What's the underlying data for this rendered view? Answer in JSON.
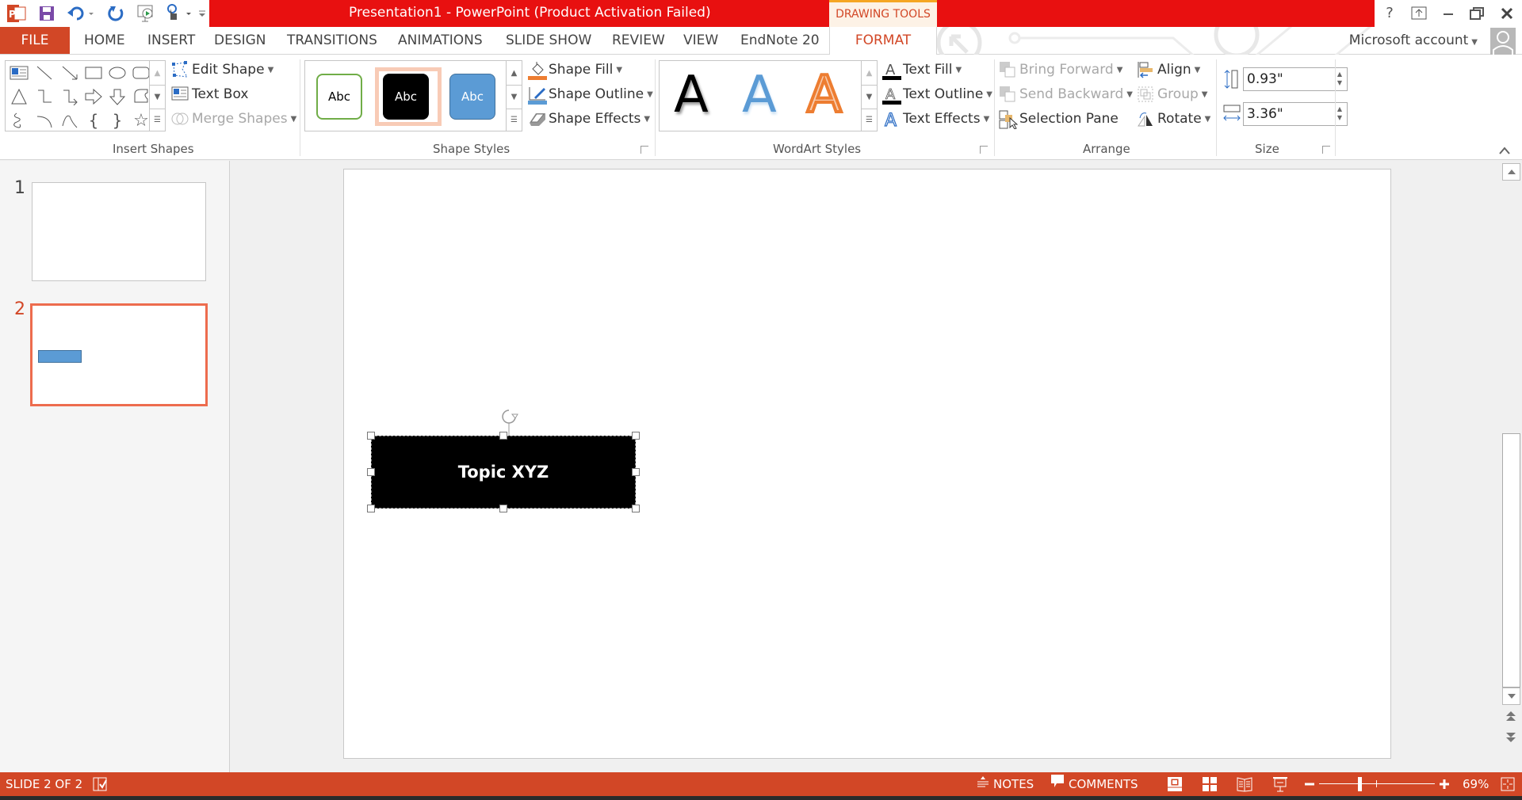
{
  "app": {
    "title": "Presentation1 -  PowerPoint (Product Activation Failed)",
    "contextual_tab_group": "DRAWING TOOLS",
    "account_label": "Microsoft account",
    "help_label": "?"
  },
  "quick_access": [
    {
      "name": "powerpoint-logo-icon"
    },
    {
      "name": "save-icon"
    },
    {
      "name": "undo-icon"
    },
    {
      "name": "redo-icon"
    },
    {
      "name": "start-from-beginning-icon"
    },
    {
      "name": "touch-mode-icon"
    },
    {
      "name": "customize-qat-icon"
    }
  ],
  "tabs": [
    {
      "label": "FILE"
    },
    {
      "label": "HOME"
    },
    {
      "label": "INSERT"
    },
    {
      "label": "DESIGN"
    },
    {
      "label": "TRANSITIONS"
    },
    {
      "label": "ANIMATIONS"
    },
    {
      "label": "SLIDE SHOW"
    },
    {
      "label": "REVIEW"
    },
    {
      "label": "VIEW"
    },
    {
      "label": "EndNote 20"
    },
    {
      "label": "FORMAT",
      "active": true
    }
  ],
  "ribbon": {
    "insert_shapes": {
      "label": "Insert Shapes",
      "edit_shape": "Edit Shape",
      "text_box": "Text Box",
      "merge_shapes": "Merge Shapes"
    },
    "shape_styles": {
      "label": "Shape Styles",
      "presets": [
        "Abc",
        "Abc",
        "Abc"
      ],
      "shape_fill": "Shape Fill",
      "shape_outline": "Shape Outline",
      "shape_effects": "Shape Effects"
    },
    "wordart_styles": {
      "label": "WordArt Styles",
      "presets": [
        "A",
        "A",
        "A"
      ],
      "text_fill": "Text Fill",
      "text_outline": "Text Outline",
      "text_effects": "Text Effects"
    },
    "arrange": {
      "label": "Arrange",
      "bring_forward": "Bring Forward",
      "send_backward": "Send Backward",
      "selection_pane": "Selection Pane",
      "align": "Align",
      "group": "Group",
      "rotate": "Rotate"
    },
    "size": {
      "label": "Size",
      "height": "0.93\"",
      "width": "3.36\""
    }
  },
  "slides": [
    {
      "number": "1"
    },
    {
      "number": "2",
      "selected": true
    }
  ],
  "slide_canvas": {
    "shape_text": "Topic XYZ"
  },
  "status": {
    "slide_indicator": "SLIDE 2 OF 2",
    "notes": "NOTES",
    "comments": "COMMENTS",
    "zoom": "69%",
    "zoom_fraction": 0.35
  },
  "colors": {
    "title_red": "#e81010",
    "accent": "#d24726",
    "shape_blue": "#5b9bd5",
    "wordart_orange": "#ed7d31"
  }
}
